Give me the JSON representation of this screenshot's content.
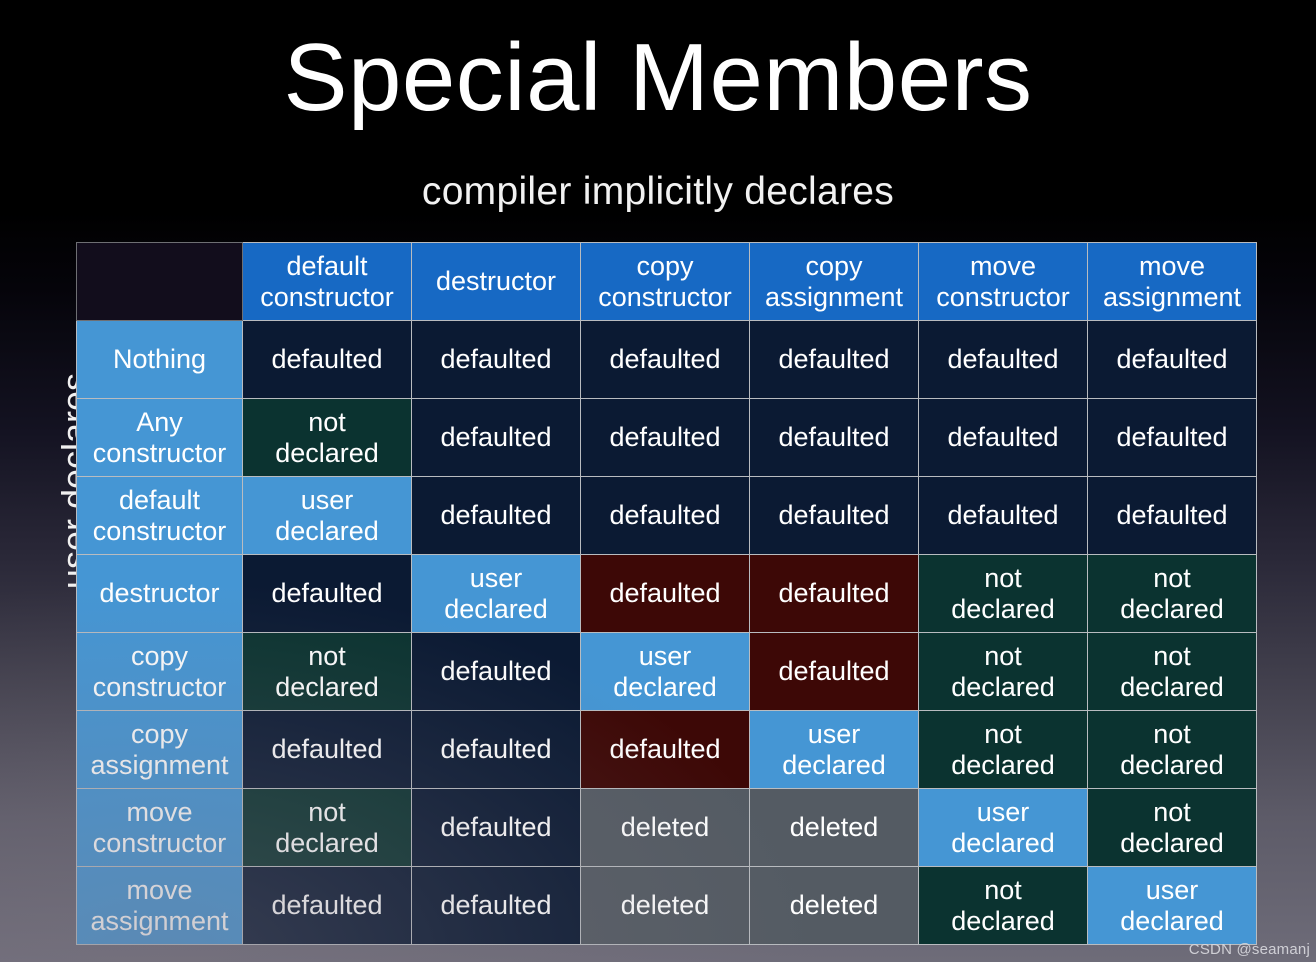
{
  "slide": {
    "title": "Special Members",
    "subtitle": "compiler implicitly declares",
    "row_axis_label": "user declares",
    "watermark": "CSDN @seamanj"
  },
  "colors": {
    "header_blue": "#1769c4",
    "row_label_blue": "#4596d4",
    "defaulted_navy": "#0b1a33",
    "not_declared_teal": "#0b3330",
    "user_declared_blue": "#4596d4",
    "defaulted_red": "#3d0806",
    "deleted_gray": "#545b63",
    "corner_dark": "#120d1c",
    "grid_border": "#b9bcc0",
    "text": "#ffffff"
  },
  "table": {
    "corner_label": "",
    "column_headers": [
      "default\nconstructor",
      "destructor",
      "copy\nconstructor",
      "copy\nassignment",
      "move\nconstructor",
      "move\nassignment"
    ],
    "column_headers_flat": {
      "c0_line1": "default",
      "c0_line2": "constructor",
      "c1_line1": "destructor",
      "c1_line2": "",
      "c2_line1": "copy",
      "c2_line2": "constructor",
      "c3_line1": "copy",
      "c3_line2": "assignment",
      "c4_line1": "move",
      "c4_line2": "constructor",
      "c5_line1": "move",
      "c5_line2": "assignment"
    },
    "row_headers": [
      {
        "line1": "Nothing",
        "line2": ""
      },
      {
        "line1": "Any",
        "line2": "constructor"
      },
      {
        "line1": "default",
        "line2": "constructor"
      },
      {
        "line1": "destructor",
        "line2": ""
      },
      {
        "line1": "copy",
        "line2": "constructor"
      },
      {
        "line1": "copy",
        "line2": "assignment"
      },
      {
        "line1": "move",
        "line2": "constructor"
      },
      {
        "line1": "move",
        "line2": "assignment"
      }
    ],
    "rows": [
      {
        "header": "Nothing",
        "cells": [
          {
            "line1": "defaulted",
            "line2": "",
            "state": "defaulted"
          },
          {
            "line1": "defaulted",
            "line2": "",
            "state": "defaulted"
          },
          {
            "line1": "defaulted",
            "line2": "",
            "state": "defaulted"
          },
          {
            "line1": "defaulted",
            "line2": "",
            "state": "defaulted"
          },
          {
            "line1": "defaulted",
            "line2": "",
            "state": "defaulted"
          },
          {
            "line1": "defaulted",
            "line2": "",
            "state": "defaulted"
          }
        ]
      },
      {
        "header": "Any constructor",
        "cells": [
          {
            "line1": "not",
            "line2": "declared",
            "state": "not-declared"
          },
          {
            "line1": "defaulted",
            "line2": "",
            "state": "defaulted"
          },
          {
            "line1": "defaulted",
            "line2": "",
            "state": "defaulted"
          },
          {
            "line1": "defaulted",
            "line2": "",
            "state": "defaulted"
          },
          {
            "line1": "defaulted",
            "line2": "",
            "state": "defaulted"
          },
          {
            "line1": "defaulted",
            "line2": "",
            "state": "defaulted"
          }
        ]
      },
      {
        "header": "default constructor",
        "cells": [
          {
            "line1": "user",
            "line2": "declared",
            "state": "user-declared"
          },
          {
            "line1": "defaulted",
            "line2": "",
            "state": "defaulted"
          },
          {
            "line1": "defaulted",
            "line2": "",
            "state": "defaulted"
          },
          {
            "line1": "defaulted",
            "line2": "",
            "state": "defaulted"
          },
          {
            "line1": "defaulted",
            "line2": "",
            "state": "defaulted"
          },
          {
            "line1": "defaulted",
            "line2": "",
            "state": "defaulted"
          }
        ]
      },
      {
        "header": "destructor",
        "cells": [
          {
            "line1": "defaulted",
            "line2": "",
            "state": "defaulted"
          },
          {
            "line1": "user",
            "line2": "declared",
            "state": "user-declared"
          },
          {
            "line1": "defaulted",
            "line2": "",
            "state": "defaulted-red"
          },
          {
            "line1": "defaulted",
            "line2": "",
            "state": "defaulted-red"
          },
          {
            "line1": "not",
            "line2": "declared",
            "state": "not-declared"
          },
          {
            "line1": "not",
            "line2": "declared",
            "state": "not-declared"
          }
        ]
      },
      {
        "header": "copy constructor",
        "cells": [
          {
            "line1": "not",
            "line2": "declared",
            "state": "not-declared"
          },
          {
            "line1": "defaulted",
            "line2": "",
            "state": "defaulted"
          },
          {
            "line1": "user",
            "line2": "declared",
            "state": "user-declared"
          },
          {
            "line1": "defaulted",
            "line2": "",
            "state": "defaulted-red"
          },
          {
            "line1": "not",
            "line2": "declared",
            "state": "not-declared"
          },
          {
            "line1": "not",
            "line2": "declared",
            "state": "not-declared"
          }
        ]
      },
      {
        "header": "copy assignment",
        "cells": [
          {
            "line1": "defaulted",
            "line2": "",
            "state": "defaulted"
          },
          {
            "line1": "defaulted",
            "line2": "",
            "state": "defaulted"
          },
          {
            "line1": "defaulted",
            "line2": "",
            "state": "defaulted-red"
          },
          {
            "line1": "user",
            "line2": "declared",
            "state": "user-declared"
          },
          {
            "line1": "not",
            "line2": "declared",
            "state": "not-declared"
          },
          {
            "line1": "not",
            "line2": "declared",
            "state": "not-declared"
          }
        ]
      },
      {
        "header": "move constructor",
        "cells": [
          {
            "line1": "not",
            "line2": "declared",
            "state": "not-declared"
          },
          {
            "line1": "defaulted",
            "line2": "",
            "state": "defaulted"
          },
          {
            "line1": "deleted",
            "line2": "",
            "state": "deleted"
          },
          {
            "line1": "deleted",
            "line2": "",
            "state": "deleted"
          },
          {
            "line1": "user",
            "line2": "declared",
            "state": "user-declared"
          },
          {
            "line1": "not",
            "line2": "declared",
            "state": "not-declared"
          }
        ]
      },
      {
        "header": "move assignment",
        "cells": [
          {
            "line1": "defaulted",
            "line2": "",
            "state": "defaulted"
          },
          {
            "line1": "defaulted",
            "line2": "",
            "state": "defaulted"
          },
          {
            "line1": "deleted",
            "line2": "",
            "state": "deleted"
          },
          {
            "line1": "deleted",
            "line2": "",
            "state": "deleted"
          },
          {
            "line1": "not",
            "line2": "declared",
            "state": "not-declared"
          },
          {
            "line1": "user",
            "line2": "declared",
            "state": "user-declared"
          }
        ]
      }
    ]
  }
}
